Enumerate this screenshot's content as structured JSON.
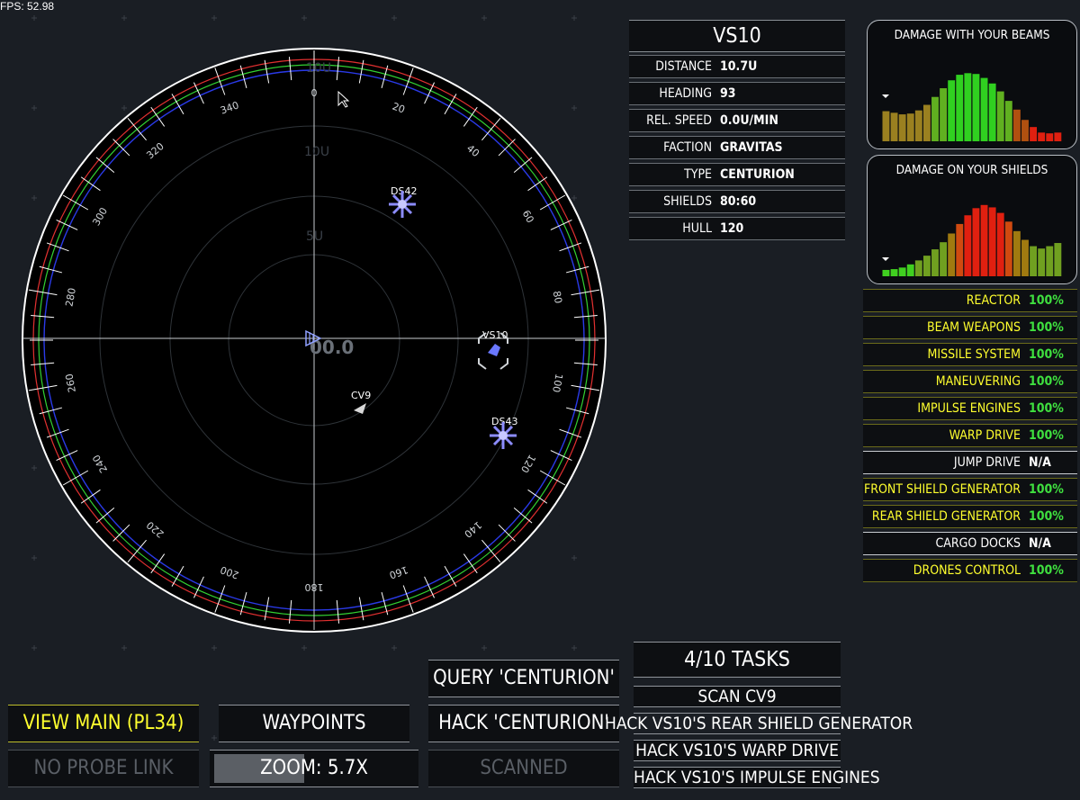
{
  "fps": "FPS: 52.98",
  "radar": {
    "range_labels": [
      "10U",
      "10U",
      "5U"
    ],
    "center_label": "00.0",
    "bearing_ticks": [
      "0",
      "20",
      "40",
      "60",
      "80",
      "100",
      "120",
      "140",
      "160",
      "180",
      "200",
      "220",
      "240",
      "260",
      "280",
      "300",
      "320",
      "340"
    ],
    "contacts": [
      {
        "label": "DS42",
        "kind": "station"
      },
      {
        "label": "DS43",
        "kind": "station"
      },
      {
        "label": "VS10",
        "kind": "target-ship"
      },
      {
        "label": "CV9",
        "kind": "ship"
      }
    ]
  },
  "target": {
    "name": "VS10",
    "rows": [
      {
        "key": "DISTANCE",
        "value": "10.7U"
      },
      {
        "key": "HEADING",
        "value": "93"
      },
      {
        "key": "REL. SPEED",
        "value": "0.0U/MIN"
      },
      {
        "key": "FACTION",
        "value": "GRAVITAS"
      },
      {
        "key": "TYPE",
        "value": "CENTURION"
      },
      {
        "key": "SHIELDS",
        "value": "80:60"
      },
      {
        "key": "HULL",
        "value": "120"
      }
    ]
  },
  "damage_beams": {
    "title": "DAMAGE WITH YOUR BEAMS",
    "values": [
      0.38,
      0.36,
      0.34,
      0.35,
      0.39,
      0.46,
      0.56,
      0.67,
      0.77,
      0.84,
      0.86,
      0.85,
      0.8,
      0.73,
      0.63,
      0.51,
      0.4,
      0.27,
      0.18,
      0.11,
      0.1,
      0.11
    ]
  },
  "damage_shields": {
    "title": "DAMAGE ON YOUR SHIELDS",
    "values": [
      0.08,
      0.09,
      0.11,
      0.15,
      0.2,
      0.26,
      0.34,
      0.43,
      0.54,
      0.66,
      0.77,
      0.86,
      0.9,
      0.87,
      0.8,
      0.69,
      0.57,
      0.46,
      0.38,
      0.35,
      0.38,
      0.42
    ]
  },
  "systems": [
    {
      "name": "REACTOR",
      "value": "100%",
      "status": "ok"
    },
    {
      "name": "BEAM WEAPONS",
      "value": "100%",
      "status": "ok"
    },
    {
      "name": "MISSILE SYSTEM",
      "value": "100%",
      "status": "ok"
    },
    {
      "name": "MANEUVERING",
      "value": "100%",
      "status": "ok"
    },
    {
      "name": "IMPULSE ENGINES",
      "value": "100%",
      "status": "ok"
    },
    {
      "name": "WARP DRIVE",
      "value": "100%",
      "status": "ok"
    },
    {
      "name": "JUMP DRIVE",
      "value": "N/A",
      "status": "na"
    },
    {
      "name": "FRONT SHIELD GENERATOR",
      "value": "100%",
      "status": "ok"
    },
    {
      "name": "REAR SHIELD GENERATOR",
      "value": "100%",
      "status": "ok"
    },
    {
      "name": "CARGO DOCKS",
      "value": "N/A",
      "status": "na"
    },
    {
      "name": "DRONES CONTROL",
      "value": "100%",
      "status": "ok"
    }
  ],
  "buttons": {
    "view_main": "VIEW MAIN (PL34)",
    "waypoints": "WAYPOINTS",
    "no_probe": "NO PROBE LINK",
    "zoom": "ZOOM: 5.7X",
    "zoom_level": 0.45,
    "query": "QUERY 'CENTURION'",
    "hack": "HACK 'CENTURION'",
    "scanned": "SCANNED"
  },
  "tasks": {
    "header": "4/10 TASKS",
    "items": [
      "SCAN CV9",
      "HACK VS10'S REAR SHIELD GENERATOR",
      "HACK VS10'S WARP DRIVE",
      "HACK VS10'S IMPULSE ENGINES"
    ]
  }
}
